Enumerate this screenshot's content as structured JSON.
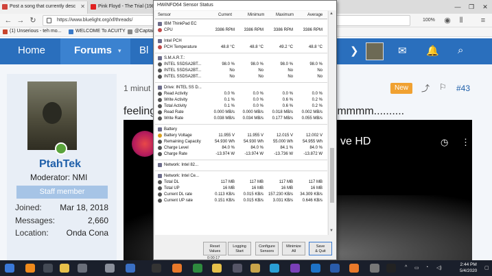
{
  "browser": {
    "tabs": [
      {
        "label": "Post a song that currently desc",
        "color": "#d0433a"
      },
      {
        "label": "Pink Floyd - The Trial (1980",
        "color": "#e02020"
      }
    ],
    "url": "https://www.bluelight.org/xf/threads/",
    "zoom": "100%",
    "bookmarks": [
      "(1) Unserious - teh mo...",
      "WELCOME To ACUITY",
      "@Captain"
    ]
  },
  "forum": {
    "nav": {
      "home": "Home",
      "forums": "Forums",
      "partial": "Bl",
      "caret": "▾"
    },
    "post_meta": "1 minut",
    "new_badge": "New",
    "post_number": "#43",
    "text_left": "feeling",
    "text_right": "mmmmm..........",
    "video_title": "ve HD",
    "user": {
      "name": "PtahTek",
      "role": "Moderator: NMI",
      "banner": "Staff member",
      "stats": [
        {
          "label": "Joined:",
          "value": "Mar 18, 2018"
        },
        {
          "label": "Messages:",
          "value": "2,660"
        },
        {
          "label": "Location:",
          "value": "Onda Cona"
        }
      ]
    }
  },
  "hwinfo": {
    "title": "HWiNFO64 Sensor Status",
    "columns": {
      "sensor": "Sensor",
      "current": "Current",
      "minimum": "Minimum",
      "maximum": "Maximum",
      "average": "Average"
    },
    "rows": [
      {
        "type": "group",
        "name": "IBM ThinkPad EC"
      },
      {
        "type": "item",
        "name": "CPU",
        "current": "3386 RPM",
        "minimum": "3386 RPM",
        "maximum": "3386 RPM",
        "average": "3386 RPM",
        "icon": "#c04a4a"
      },
      {
        "type": "sep"
      },
      {
        "type": "group",
        "name": "Intel PCH"
      },
      {
        "type": "item",
        "name": "PCH Temperature",
        "current": "48.8 °C",
        "minimum": "48.8 °C",
        "maximum": "49.2 °C",
        "average": "48.8 °C",
        "icon": "#c04a4a"
      },
      {
        "type": "sep"
      },
      {
        "type": "group",
        "name": "S.M.A.R.T.:"
      },
      {
        "type": "item",
        "name": "INTEL SSDSA2BT...",
        "current": "98.0 %",
        "minimum": "98.0 %",
        "maximum": "98.0 %",
        "average": "98.0 %",
        "icon": "#555555"
      },
      {
        "type": "item",
        "name": "INTEL SSDSA2BT...",
        "current": "No",
        "minimum": "No",
        "maximum": "No",
        "average": "No",
        "icon": "#555555"
      },
      {
        "type": "item",
        "name": "INTEL SSDSA2BT...",
        "current": "No",
        "minimum": "No",
        "maximum": "No",
        "average": "No",
        "icon": "#555555"
      },
      {
        "type": "sep"
      },
      {
        "type": "group",
        "name": "Drive: INTEL SS D..."
      },
      {
        "type": "item",
        "name": "Read Activity",
        "current": "0.0 %",
        "minimum": "0.0 %",
        "maximum": "0.0 %",
        "average": "0.0 %",
        "icon": "#555555"
      },
      {
        "type": "item",
        "name": "Write Activity",
        "current": "0.1 %",
        "minimum": "0.0 %",
        "maximum": "0.6 %",
        "average": "0.2 %",
        "icon": "#555555"
      },
      {
        "type": "item",
        "name": "Total Activity",
        "current": "0.1 %",
        "minimum": "0.0 %",
        "maximum": "0.6 %",
        "average": "0.2 %",
        "icon": "#555555"
      },
      {
        "type": "item",
        "name": "Read Rate",
        "current": "0.000 MB/s",
        "minimum": "0.000 MB/s",
        "maximum": "0.018 MB/s",
        "average": "0.002 MB/s",
        "icon": "#555555"
      },
      {
        "type": "item",
        "name": "Write Rate",
        "current": "0.038 MB/s",
        "minimum": "0.034 MB/s",
        "maximum": "0.177 MB/s",
        "average": "0.055 MB/s",
        "icon": "#555555"
      },
      {
        "type": "sep"
      },
      {
        "type": "group",
        "name": "Battery"
      },
      {
        "type": "item",
        "name": "Battery Voltage",
        "current": "11.955 V",
        "minimum": "11.955 V",
        "maximum": "12.015 V",
        "average": "12.002 V",
        "icon": "#d8a020"
      },
      {
        "type": "item",
        "name": "Remaining Capacity",
        "current": "54.930 Wh",
        "minimum": "54.930 Wh",
        "maximum": "55.000 Wh",
        "average": "54.955 Wh",
        "icon": "#555555"
      },
      {
        "type": "item",
        "name": "Charge Level",
        "current": "84.0 %",
        "minimum": "84.0 %",
        "maximum": "84.1 %",
        "average": "84.0 %",
        "icon": "#555555"
      },
      {
        "type": "item",
        "name": "Charge Rate",
        "current": "-13.974 W",
        "minimum": "-13.974 W",
        "maximum": "-13.736 W",
        "average": "-13.872 W",
        "icon": "#555555"
      },
      {
        "type": "sep"
      },
      {
        "type": "group",
        "name": "Network: Intel 82..."
      },
      {
        "type": "sep"
      },
      {
        "type": "group",
        "name": "Network: Intel Ce..."
      },
      {
        "type": "item",
        "name": "Total DL",
        "current": "117 MB",
        "minimum": "117 MB",
        "maximum": "117 MB",
        "average": "117 MB",
        "icon": "#555555"
      },
      {
        "type": "item",
        "name": "Total UP",
        "current": "16 MB",
        "minimum": "16 MB",
        "maximum": "16 MB",
        "average": "16 MB",
        "icon": "#555555"
      },
      {
        "type": "item",
        "name": "Current DL rate",
        "current": "0.113 KB/s",
        "minimum": "0.015 KB/s",
        "maximum": "157.230 KB/s",
        "average": "34.309 KB/s",
        "icon": "#555555"
      },
      {
        "type": "item",
        "name": "Current UP rate",
        "current": "0.151 KB/s",
        "minimum": "0.015 KB/s",
        "maximum": "3.031 KB/s",
        "average": "0.646 KB/s",
        "icon": "#555555"
      }
    ],
    "buttons": [
      {
        "line1": "Reset",
        "line2": "Values"
      },
      {
        "line1": "Logging",
        "line2": "Start"
      },
      {
        "line1": "Configure",
        "line2": "Sensors"
      },
      {
        "line1": "Minimize",
        "line2": "All"
      },
      {
        "line1": "Save",
        "line2": "& Quit"
      }
    ],
    "timer": "0:00:17"
  },
  "taskbar": {
    "icons": [
      {
        "name": "start",
        "color": "#3a78d8"
      },
      {
        "name": "vlc",
        "color": "#f08a1c"
      },
      {
        "name": "media",
        "color": "#444a55"
      },
      {
        "name": "explorer",
        "color": "#e6c04a"
      },
      {
        "name": "app",
        "color": "#6a6f7a"
      },
      {
        "name": "settings",
        "color": "#8a8f9a"
      },
      {
        "name": "text",
        "color": "#3a6fc4"
      },
      {
        "name": "cmd",
        "color": "#333"
      },
      {
        "name": "firefox",
        "color": "#e8792a"
      },
      {
        "name": "hwinfo",
        "color": "#2e8a3e"
      },
      {
        "name": "folder",
        "color": "#e6c04a"
      },
      {
        "name": "game",
        "color": "#556"
      },
      {
        "name": "archive",
        "color": "#c9a44a"
      },
      {
        "name": "kodi",
        "color": "#2a9fd6"
      },
      {
        "name": "tor",
        "color": "#7a3fb8"
      },
      {
        "name": "ie",
        "color": "#1e73c8"
      },
      {
        "name": "word",
        "color": "#2a5caa"
      },
      {
        "name": "firefox2",
        "color": "#e8792a"
      },
      {
        "name": "tools",
        "color": "#777"
      },
      {
        "name": "terminal",
        "color": "#222"
      }
    ],
    "time": "2:44 PM",
    "date": "5/4/2020"
  }
}
